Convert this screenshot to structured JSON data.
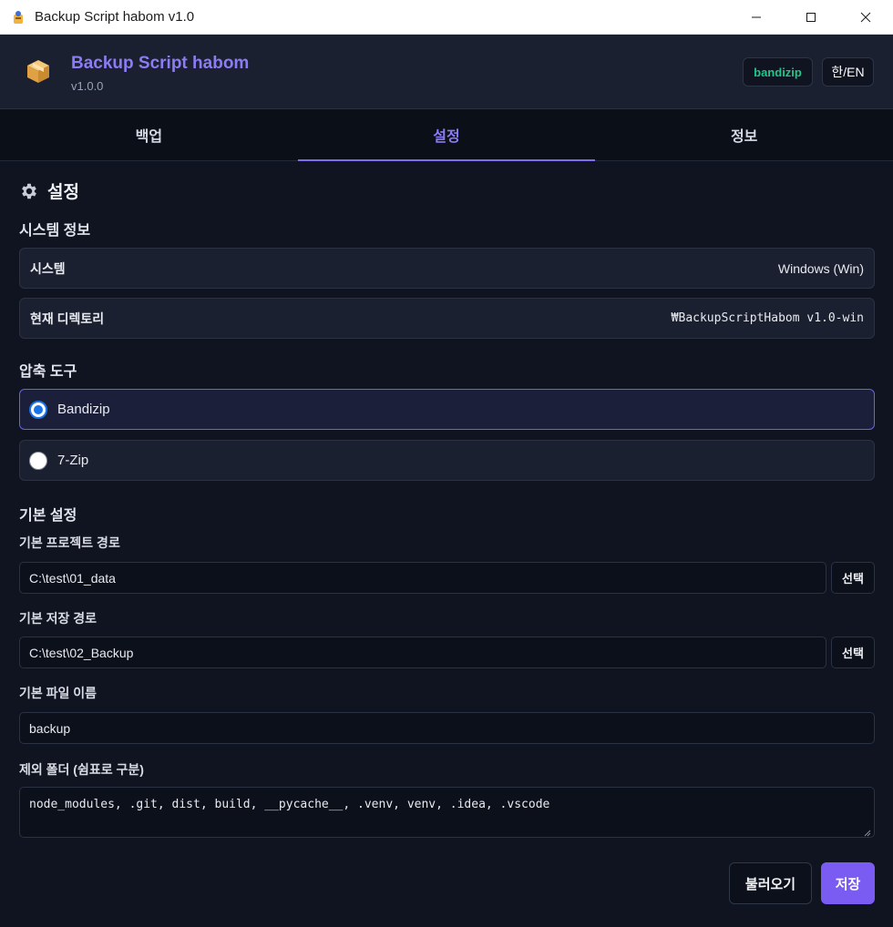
{
  "window": {
    "title": "Backup Script habom v1.0",
    "controls": [
      "minimize",
      "maximize",
      "close"
    ]
  },
  "header": {
    "app_name": "Backup Script habom",
    "version": "v1.0.0",
    "tool_badge": "bandizip",
    "lang_toggle": "한/EN"
  },
  "tabs": [
    {
      "label": "백업",
      "active": false
    },
    {
      "label": "설정",
      "active": true
    },
    {
      "label": "정보",
      "active": false
    }
  ],
  "settings": {
    "title": "설정",
    "system_info": {
      "heading": "시스템 정보",
      "system_label": "시스템",
      "system_value": "Windows (Win)",
      "dir_label": "현재 디렉토리",
      "dir_value": "₩BackupScriptHabom v1.0-win"
    },
    "compression": {
      "heading": "압축 도구",
      "options": [
        {
          "label": "Bandizip",
          "selected": true
        },
        {
          "label": "7-Zip",
          "selected": false
        }
      ]
    },
    "defaults": {
      "heading": "기본 설정",
      "project_path_label": "기본 프로젝트 경로",
      "project_path_value": "C:\\test\\01_data",
      "save_path_label": "기본 저장 경로",
      "save_path_value": "C:\\test\\02_Backup",
      "select_label": "선택",
      "file_name_label": "기본 파일 이름",
      "file_name_value": "backup",
      "exclude_label": "제외 폴더 (쉼표로 구분)",
      "exclude_value": "node_modules, .git, dist, build, __pycache__, .venv, venv, .idea, .vscode"
    },
    "actions": {
      "load_label": "불러오기",
      "save_label": "저장"
    }
  },
  "colors": {
    "accent": "#8b7cf6",
    "save_button": "#7a5cf2",
    "badge_green": "#22c58a",
    "radio_blue": "#1a73e8"
  }
}
